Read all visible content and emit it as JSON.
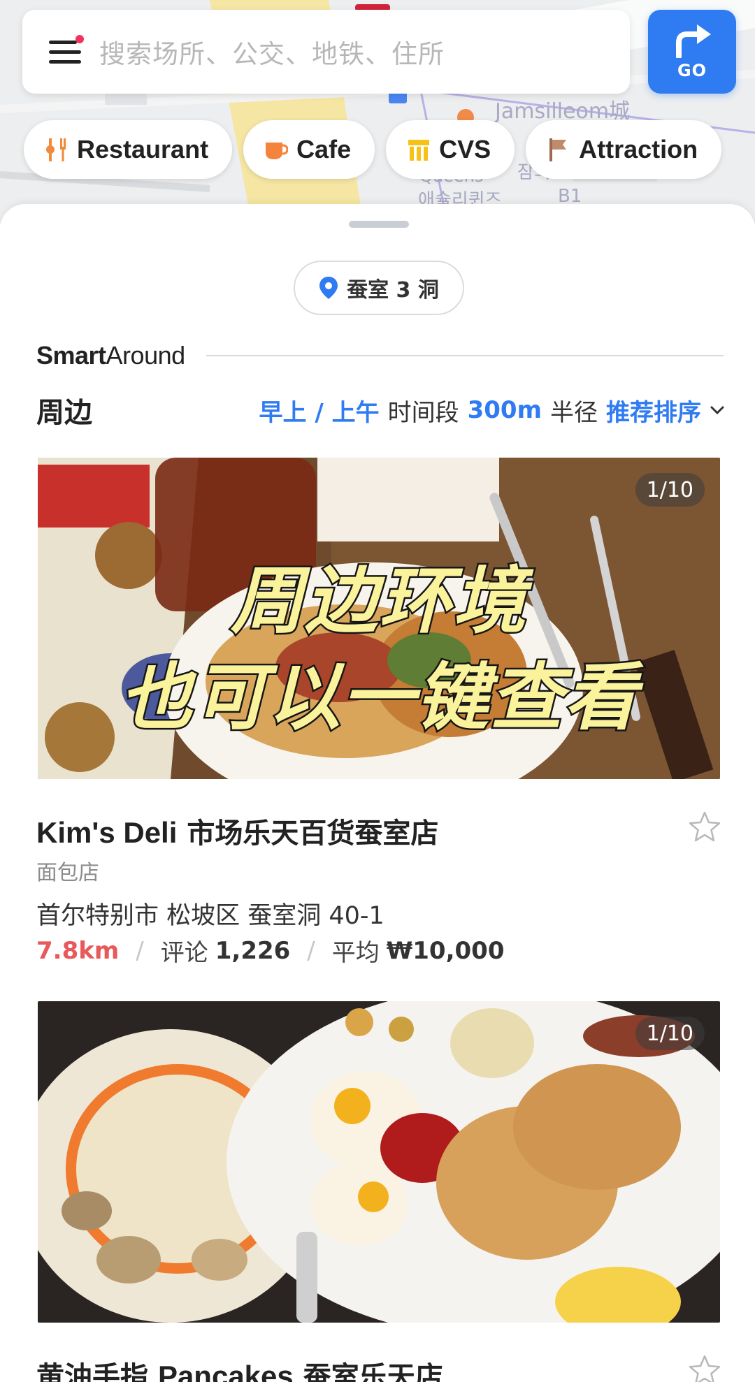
{
  "search": {
    "placeholder": "搜索场所、公交、地铁、住所",
    "go_label": "GO"
  },
  "map_labels": [
    "Jamsilleom城",
    "Queens",
    "잠의",
    "애슐리퀸즈",
    "B1"
  ],
  "categories": [
    {
      "label": "Restaurant",
      "icon": "fork-knife-icon"
    },
    {
      "label": "Cafe",
      "icon": "coffee-cup-icon"
    },
    {
      "label": "CVS",
      "icon": "store-icon"
    },
    {
      "label": "Attraction",
      "icon": "flag-icon"
    }
  ],
  "location": {
    "name": "蚕室 3 洞"
  },
  "smart_around": {
    "bold": "Smart",
    "regular": "Around"
  },
  "nearby": {
    "title": "周边",
    "time_value": "早上 / 上午",
    "time_label": "时间段",
    "radius_value": "300m",
    "radius_label": "半径",
    "sort_label": "推荐排序"
  },
  "places": [
    {
      "photo_counter": "1/10",
      "overlay_line1": "周边环境",
      "overlay_line2": "也可以一键查看",
      "name_latin": "Kim's Deli",
      "name_cjk": " 市场乐天百货蚕室店",
      "category": "面包店",
      "address": "首尔特别市 松坡区 蚕室洞 40-1",
      "distance": "7.8km",
      "reviews_label": "评论",
      "reviews": "1,226",
      "price_label": "平均",
      "price": "₩10,000"
    },
    {
      "photo_counter": "1/10",
      "name_cjk_prefix": "黄油手指 ",
      "name_latin": "Pancakes",
      "name_cjk": " 蚕室乐天店"
    }
  ],
  "colors": {
    "accent_blue": "#2f7bf2",
    "distance_red": "#e8595a",
    "overlay_yellow": "#fbf39c"
  }
}
